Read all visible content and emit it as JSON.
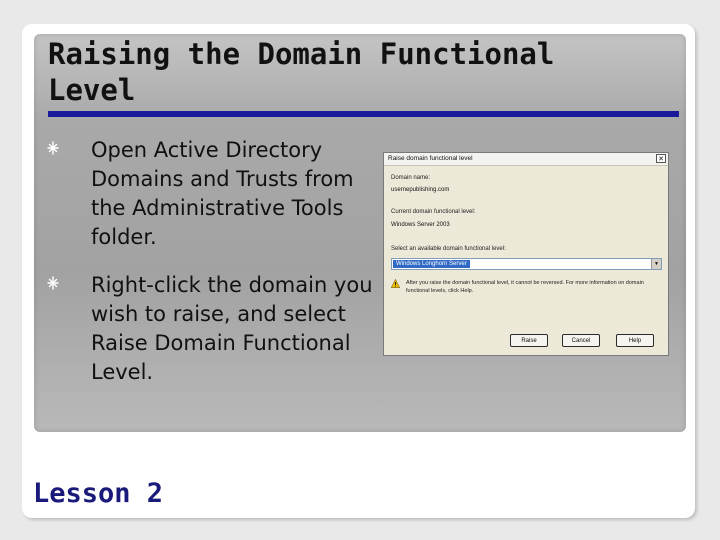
{
  "slide": {
    "title": "Raising the Domain Functional Level",
    "bullets": [
      "Open Active Directory Domains and Trusts from the Administrative Tools folder.",
      "Right-click the domain you wish to raise, and select Raise Domain Functional Level."
    ],
    "footer": "Lesson 2",
    "bullet_icon": "starburst-bullet-icon",
    "colors": {
      "title_rule": "#1a1a9a",
      "footer": "#1a1a7a"
    }
  },
  "dialog": {
    "title": "Raise domain functional level",
    "close_glyph": "✕",
    "domain_name_label": "Domain name:",
    "domain_name_value": "usernepublishing.com",
    "current_level_label": "Current domain functional level:",
    "current_level_value": "Windows Server 2003",
    "select_label": "Select an available domain functional level:",
    "selected_level": "Windows Longhorn Server",
    "dropdown_arrow": "▼",
    "warning_icon": "warning-triangle-icon",
    "warning_text": "After you raise the domain functional level, it cannot be reversed. For more information on domain functional levels, click Help.",
    "buttons": {
      "raise": "Raise",
      "cancel": "Cancel",
      "help": "Help"
    }
  }
}
